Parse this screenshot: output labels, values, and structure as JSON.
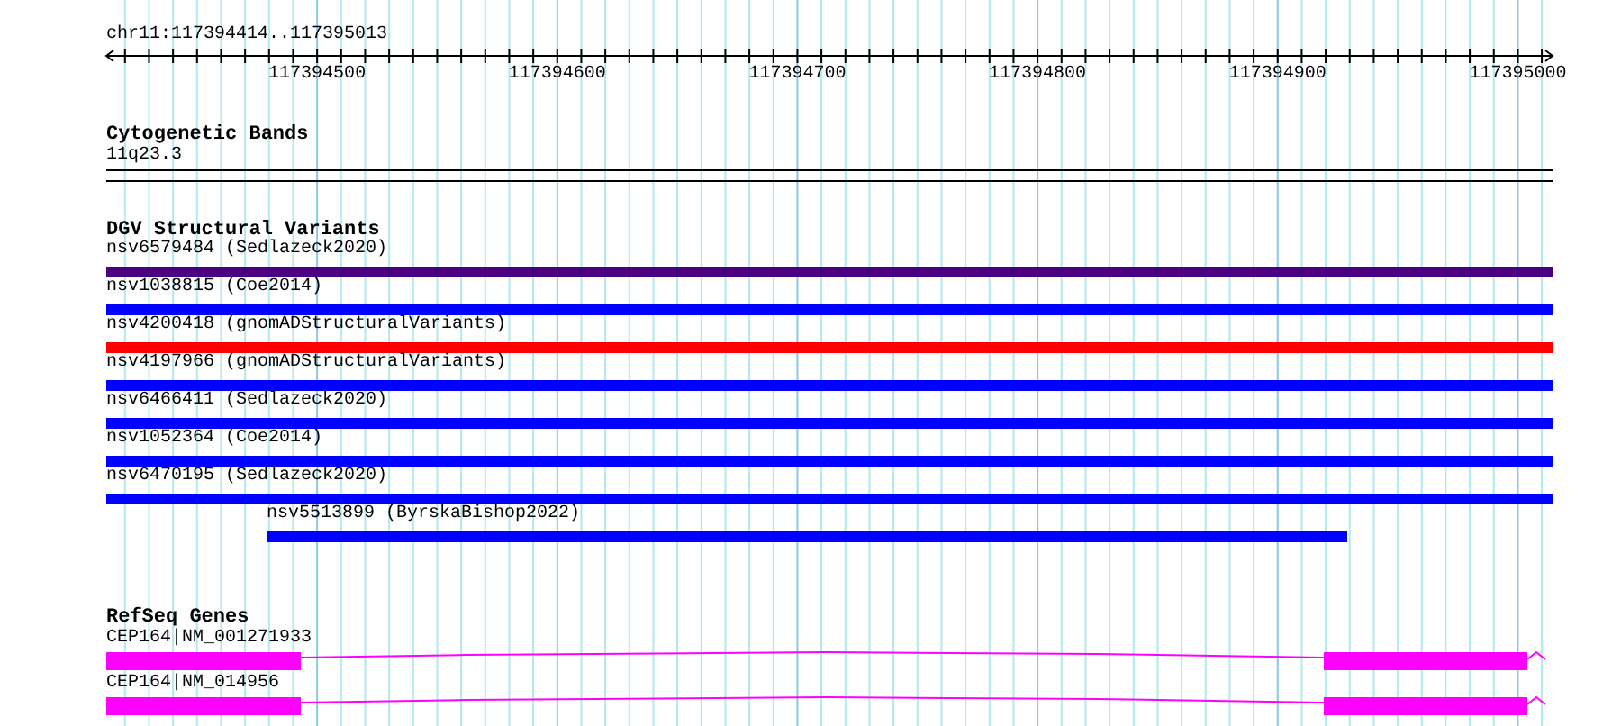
{
  "ruler": {
    "location": "chr11:117394414..117395013",
    "tick_labels": [
      "117394500",
      "117394600",
      "117394700",
      "117394800",
      "117394900",
      "117395000"
    ]
  },
  "tracks": [
    {
      "title": "Cytogenetic Bands",
      "kind": "bands",
      "features": [
        {
          "label": "11q23.3"
        }
      ]
    },
    {
      "title": "DGV Structural Variants",
      "kind": "variants",
      "features": [
        {
          "label": "nsv6579484 (Sedlazeck2020)",
          "color": "#4b0082",
          "kind": "full"
        },
        {
          "label": "nsv1038815 (Coe2014)",
          "color": "#0000ff",
          "kind": "full"
        },
        {
          "label": "nsv4200418 (gnomADStructuralVariants)",
          "color": "#ff0000",
          "kind": "full"
        },
        {
          "label": "nsv4197966 (gnomADStructuralVariants)",
          "color": "#0000ff",
          "kind": "full"
        },
        {
          "label": "nsv6466411 (Sedlazeck2020)",
          "color": "#0000ff",
          "kind": "full"
        },
        {
          "label": "nsv1052364 (Coe2014)",
          "color": "#0000ff",
          "kind": "full"
        },
        {
          "label": "nsv6470195 (Sedlazeck2020)",
          "color": "#0000ff",
          "kind": "full"
        },
        {
          "label": "nsv5513899 (ByrskaBishop2022)",
          "color": "#0000ff",
          "kind": "partial"
        }
      ]
    },
    {
      "title": "RefSeq Genes",
      "kind": "genes",
      "features": [
        {
          "label": "CEP164|NM_001271933"
        },
        {
          "label": "CEP164|NM_014956"
        }
      ]
    }
  ]
}
